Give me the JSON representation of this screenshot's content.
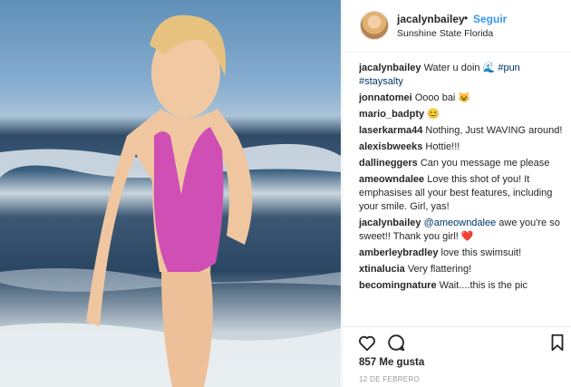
{
  "post": {
    "username": "jacalynbailey",
    "separator": "•",
    "follow_label": "Seguir",
    "location": "Sunshine State Florida"
  },
  "comments": [
    {
      "user": "jacalynbailey",
      "text": "Water u doin 🌊 ",
      "tags": "#pun #staysalty"
    },
    {
      "user": "jonnatomei",
      "text": "Oooo bai 😺"
    },
    {
      "user": "mario_badpty",
      "text": "😊"
    },
    {
      "user": "laserkarma44",
      "text": "Nothing, Just WAVING around!"
    },
    {
      "user": "alexisbweeks",
      "text": "Hottie!!!"
    },
    {
      "user": "dallineggers",
      "text": "Can you message me please"
    },
    {
      "user": "ameowndalee",
      "text": "Love this shot of you! It emphasises all your best features, including your smile. Girl, yas!"
    },
    {
      "user": "jacalynbailey",
      "mention": "@ameowndalee",
      "text": " awe you're so sweet!! Thank you girl! ❤️"
    },
    {
      "user": "amberleybradley",
      "text": "love this swimsuit!"
    },
    {
      "user": "xtinalucia",
      "text": "Very flattering!"
    },
    {
      "user": "becomingnature",
      "text": "Wait....this is the pic"
    }
  ],
  "footer": {
    "likes": "857 Me gusta",
    "date": "12 DE FEBRERO"
  },
  "icons": {
    "like": "heart-icon",
    "comment": "comment-icon",
    "save": "bookmark-icon"
  },
  "colors": {
    "link": "#3897f0",
    "text": "#262626",
    "muted": "#999999"
  }
}
